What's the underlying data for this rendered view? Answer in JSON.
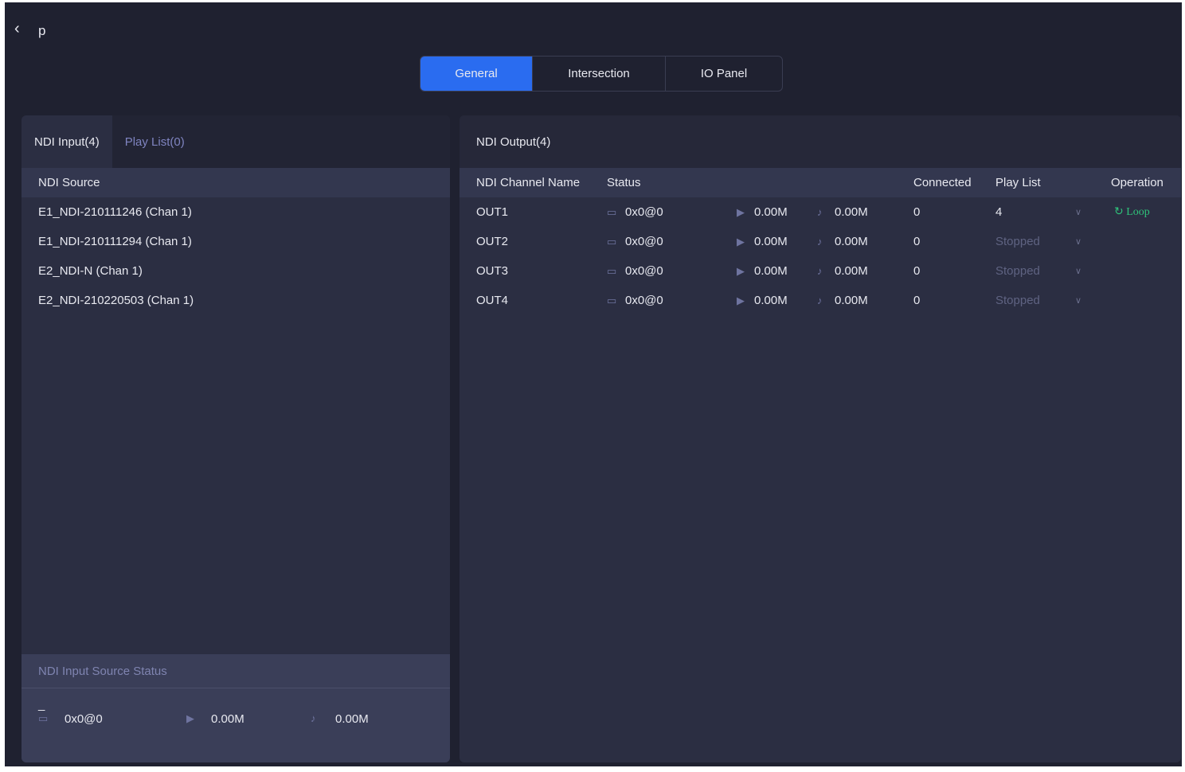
{
  "header": {
    "back_icon": "chevron-left-icon",
    "title": "p"
  },
  "tabs": [
    {
      "label": "General"
    },
    {
      "label": "Intersection"
    },
    {
      "label": "IO Panel"
    }
  ],
  "left": {
    "tabs": [
      {
        "label": "NDI Input(4)"
      },
      {
        "label": "Play List(0)"
      }
    ],
    "column": "NDI Source",
    "sources": [
      "E1_NDI-210111246 (Chan 1)",
      "E1_NDI-210111294 (Chan 1)",
      "E2_NDI-N (Chan 1)",
      "E2_NDI-210220503 (Chan 1)"
    ],
    "status": {
      "title": "NDI Input Source Status",
      "name": "_",
      "resolution": "0x0@0",
      "video": "0.00M",
      "audio": "0.00M"
    }
  },
  "right": {
    "title": "NDI Output(4)",
    "columns": {
      "name": "NDI Channel Name",
      "status": "Status",
      "connected": "Connected",
      "playlist": "Play List",
      "operation": "Operation"
    },
    "rows": [
      {
        "name": "OUT1",
        "resolution": "0x0@0",
        "video": "0.00M",
        "audio": "0.00M",
        "connected": "0",
        "playlist": "4",
        "operation": "Loop"
      },
      {
        "name": "OUT2",
        "resolution": "0x0@0",
        "video": "0.00M",
        "audio": "0.00M",
        "connected": "0",
        "playlist": "Stopped",
        "operation": ""
      },
      {
        "name": "OUT3",
        "resolution": "0x0@0",
        "video": "0.00M",
        "audio": "0.00M",
        "connected": "0",
        "playlist": "Stopped",
        "operation": ""
      },
      {
        "name": "OUT4",
        "resolution": "0x0@0",
        "video": "0.00M",
        "audio": "0.00M",
        "connected": "0",
        "playlist": "Stopped",
        "operation": ""
      }
    ]
  },
  "colors": {
    "accent": "#2a6cf0",
    "loop": "#2fc27a"
  }
}
